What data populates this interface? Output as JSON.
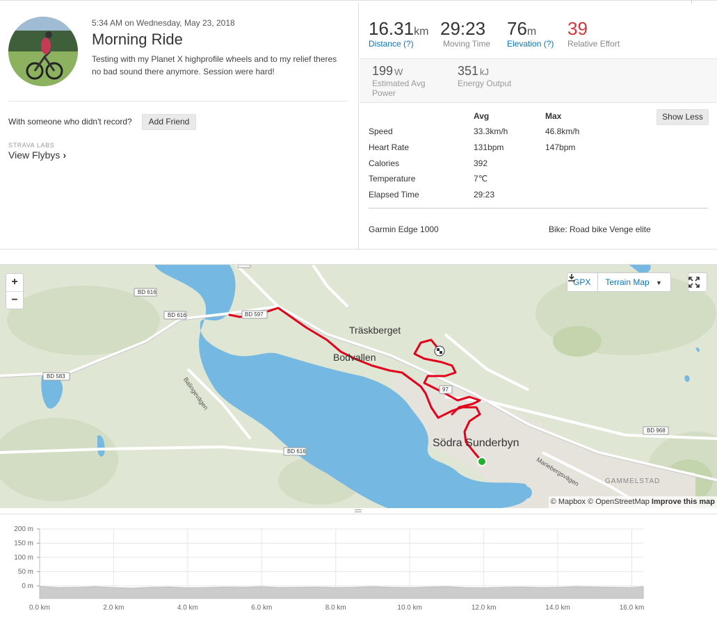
{
  "activity": {
    "datetime": "5:34 AM on Wednesday, May 23, 2018",
    "title": "Morning Ride",
    "description": "Testing with my Planet X highprofile wheels and to my relief theres no bad sound there anymore. Session were hard!"
  },
  "social": {
    "question": "With someone who didn't record?",
    "add_friend": "Add Friend",
    "labs_label": "STRAVA LABS",
    "flybys": "View Flybys"
  },
  "primary_stats": [
    {
      "value": "16.31",
      "unit": "km",
      "label": "Distance (?)",
      "link": true
    },
    {
      "value": "29:23",
      "unit": "",
      "label": "Moving Time",
      "link": false
    },
    {
      "value": "76",
      "unit": "m",
      "label": "Elevation (?)",
      "link": true
    },
    {
      "value": "39",
      "unit": "",
      "label": "Relative Effort",
      "link": false
    }
  ],
  "secondary_stats": [
    {
      "value": "199",
      "unit": "W",
      "label_line1": "Estimated Avg",
      "label_line2": "Power"
    },
    {
      "value": "351",
      "unit": "kJ",
      "label_line1": "Energy Output",
      "label_line2": ""
    }
  ],
  "details": {
    "avg_header": "Avg",
    "max_header": "Max",
    "show_less": "Show Less",
    "rows": [
      {
        "label": "Speed",
        "avg": "33.3km/h",
        "max": "46.8km/h"
      },
      {
        "label": "Heart Rate",
        "avg": "131bpm",
        "max": "147bpm"
      },
      {
        "label": "Calories",
        "avg": "392",
        "max": ""
      },
      {
        "label": "Temperature",
        "avg": "7℃",
        "max": ""
      },
      {
        "label": "Elapsed Time",
        "avg": "29:23",
        "max": ""
      }
    ],
    "device": "Garmin Edge 1000",
    "bike": "Bike: Road bike Venge elite"
  },
  "map": {
    "zoom_in": "+",
    "zoom_out": "−",
    "gpx": "GPX",
    "terrain": "Terrain Map",
    "attribution_mapbox": "© Mapbox",
    "attribution_osm": "© OpenStreetMap",
    "improve": "Improve this map",
    "labels": {
      "traskberget": "Träskberget",
      "bodvallen": "Bodvallen",
      "sodra": "Södra Sunderbyn",
      "gammelstad": "GAMMELSTAD",
      "mariebergs": "Mariebergsvägen",
      "balinge": "Balingevägen",
      "road97": "97",
      "bd616a": "BD 616",
      "bd616b": "BD 616",
      "bd616c": "BD 616",
      "bd583": "BD 583",
      "bd968": "BD 968",
      "bd597": "BD 597",
      "top97": "97"
    },
    "colors": {
      "water": "#75b9e3",
      "route": "#e3001b",
      "land": "#dfe7d4",
      "start": "#22b02c"
    }
  },
  "chart_data": {
    "type": "area",
    "title": "",
    "xlabel": "",
    "ylabel": "",
    "x_ticks": [
      "0.0 km",
      "2.0 km",
      "4.0 km",
      "6.0 km",
      "8.0 km",
      "10.0 km",
      "12.0 km",
      "14.0 km",
      "16.0 km"
    ],
    "y_ticks": [
      "200 m",
      "150 m",
      "100 m",
      "50 m",
      "0 m"
    ],
    "xlim": [
      0,
      16.31
    ],
    "ylim": [
      0,
      200
    ],
    "x": [
      0,
      0.5,
      1,
      1.5,
      2,
      2.5,
      3,
      3.5,
      4,
      4.5,
      5,
      5.5,
      6,
      6.5,
      7,
      7.5,
      8,
      8.5,
      9,
      9.5,
      10,
      10.5,
      11,
      11.5,
      12,
      12.5,
      13,
      13.5,
      14,
      14.5,
      15,
      15.5,
      16,
      16.31
    ],
    "y": [
      -2,
      -6,
      -5,
      -3,
      -6,
      -8,
      -5,
      -4,
      -7,
      -6,
      -4,
      -5,
      -3,
      -6,
      -5,
      -4,
      -6,
      -5,
      -3,
      -5,
      -6,
      -4,
      -3,
      -6,
      -7,
      -5,
      -4,
      -6,
      -5,
      -3,
      -4,
      -5,
      -6,
      -3
    ],
    "grid": true,
    "color": "#cccccc"
  }
}
